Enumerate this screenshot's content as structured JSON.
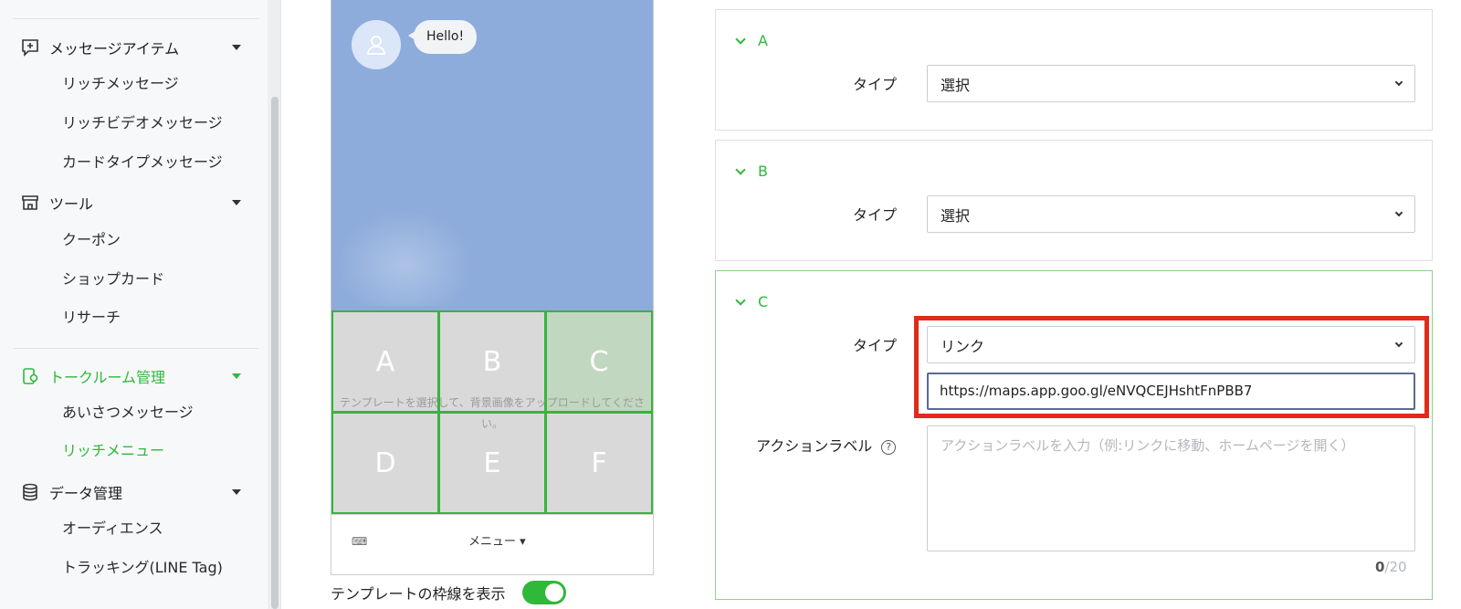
{
  "sidebar": {
    "sections": [
      {
        "label": "メッセージアイテム",
        "icon": "message-plus-icon"
      },
      {
        "label": "ツール",
        "icon": "shop-icon"
      },
      {
        "label": "トークルーム管理",
        "icon": "chatroom-settings-icon"
      },
      {
        "label": "データ管理",
        "icon": "database-icon"
      }
    ],
    "items": {
      "rich_message": "リッチメッセージ",
      "rich_video": "リッチビデオメッセージ",
      "card_type": "カードタイプメッセージ",
      "coupon": "クーポン",
      "shop_card": "ショップカード",
      "research": "リサーチ",
      "greeting": "あいさつメッセージ",
      "rich_menu": "リッチメニュー",
      "audience": "オーディエンス",
      "tracking": "トラッキング(LINE Tag)"
    }
  },
  "preview": {
    "bubble": "Hello!",
    "cells": [
      "A",
      "B",
      "C",
      "D",
      "E",
      "F"
    ],
    "selected_cell": "C",
    "hint": "テンプレートを選択して、背景画像をアップロードしてください。",
    "keyboard_icon": "keyboard-icon",
    "menu_label": "メニュー ▾",
    "border_toggle_label": "テンプレートの枠線を表示",
    "border_toggle_on": true
  },
  "panels": {
    "a": {
      "title": "A",
      "type_label": "タイプ",
      "type_value": "選択"
    },
    "b": {
      "title": "B",
      "type_label": "タイプ",
      "type_value": "選択"
    },
    "c": {
      "title": "C",
      "type_label": "タイプ",
      "type_value": "リンク",
      "url": "https://maps.app.goo.gl/eNVQCEJHshtFnPBB7",
      "action_label": "アクションラベル",
      "action_placeholder": "アクションラベルを入力（例:リンクに移動、ホームページを開く）",
      "count": "0",
      "max": "/20"
    }
  },
  "colors": {
    "accent": "#2fb83a",
    "highlight": "#e02a1a",
    "chat_bg": "#8eacdb"
  }
}
